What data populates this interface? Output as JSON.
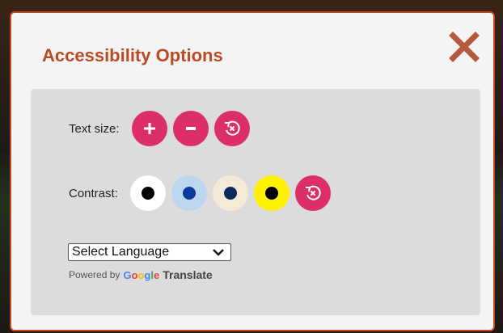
{
  "dialog": {
    "title": "Accessibility Options",
    "close_icon": "close-icon"
  },
  "text_size": {
    "label": "Text size:",
    "buttons": [
      {
        "name": "increase",
        "icon": "plus-icon"
      },
      {
        "name": "decrease",
        "icon": "minus-icon"
      },
      {
        "name": "reset",
        "icon": "reset-icon"
      }
    ]
  },
  "contrast": {
    "label": "Contrast:",
    "options": [
      {
        "name": "default",
        "bg": "#ffffff",
        "dot": "#000000"
      },
      {
        "name": "light-blue",
        "bg": "#bcd6ef",
        "dot": "#0b3a9b"
      },
      {
        "name": "beige",
        "bg": "#f5ead7",
        "dot": "#0e2a5c"
      },
      {
        "name": "yellow",
        "bg": "#fff200",
        "dot": "#000000"
      }
    ],
    "reset_icon": "reset-icon"
  },
  "language": {
    "selected": "Select Language",
    "powered_by": "Powered by",
    "google_logo": "Google",
    "translate": "Translate"
  },
  "colors": {
    "accent": "#dc2f68",
    "title": "#b94a24",
    "border": "#c2491f",
    "close": "#b55a3c"
  }
}
